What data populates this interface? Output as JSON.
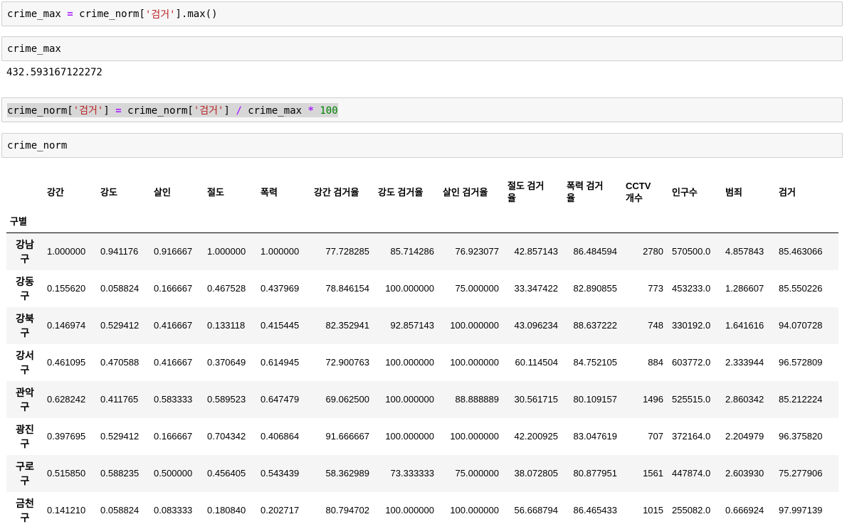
{
  "cells": {
    "c1": {
      "a": "crime_max",
      "b": "=",
      "c": "crime_norm[",
      "d": "'검거'",
      "e": "].max()"
    },
    "c2": {
      "code": "crime_max",
      "output": "432.593167122272"
    },
    "c3": {
      "a": "crime_norm[",
      "b": "'검거'",
      "c": "]",
      "d": "=",
      "e": "crime_norm[",
      "f": "'검거'",
      "g": "]",
      "h": "/",
      "i": "crime_max",
      "j": "*",
      "k": "100"
    },
    "c4": {
      "code": "crime_norm"
    }
  },
  "table": {
    "columns": [
      "강간",
      "강도",
      "살인",
      "절도",
      "폭력",
      "강간 검거율",
      "강도 검거율",
      "살인 검거율",
      "절도 검거\n율",
      "폭력 검거\n율",
      "CCTV\n개수",
      "인구수",
      "범죄",
      "검거"
    ],
    "index_name": "구별",
    "rows": [
      {
        "idx": "강남\n구",
        "vals": [
          "1.000000",
          "0.941176",
          "0.916667",
          "1.000000",
          "1.000000",
          "77.728285",
          "85.714286",
          "76.923077",
          "42.857143",
          "86.484594",
          "2780",
          "570500.0",
          "4.857843",
          "85.463066"
        ]
      },
      {
        "idx": "강동\n구",
        "vals": [
          "0.155620",
          "0.058824",
          "0.166667",
          "0.467528",
          "0.437969",
          "78.846154",
          "100.000000",
          "75.000000",
          "33.347422",
          "82.890855",
          "773",
          "453233.0",
          "1.286607",
          "85.550226"
        ]
      },
      {
        "idx": "강북\n구",
        "vals": [
          "0.146974",
          "0.529412",
          "0.416667",
          "0.133118",
          "0.415445",
          "82.352941",
          "92.857143",
          "100.000000",
          "43.096234",
          "88.637222",
          "748",
          "330192.0",
          "1.641616",
          "94.070728"
        ]
      },
      {
        "idx": "강서\n구",
        "vals": [
          "0.461095",
          "0.470588",
          "0.416667",
          "0.370649",
          "0.614945",
          "72.900763",
          "100.000000",
          "100.000000",
          "60.114504",
          "84.752105",
          "884",
          "603772.0",
          "2.333944",
          "96.572809"
        ]
      },
      {
        "idx": "관악\n구",
        "vals": [
          "0.628242",
          "0.411765",
          "0.583333",
          "0.589523",
          "0.647479",
          "69.062500",
          "100.000000",
          "88.888889",
          "30.561715",
          "80.109157",
          "1496",
          "525515.0",
          "2.860342",
          "85.212224"
        ]
      },
      {
        "idx": "광진\n구",
        "vals": [
          "0.397695",
          "0.529412",
          "0.166667",
          "0.704342",
          "0.406864",
          "91.666667",
          "100.000000",
          "100.000000",
          "42.200925",
          "83.047619",
          "707",
          "372164.0",
          "2.204979",
          "96.375820"
        ]
      },
      {
        "idx": "구로\n구",
        "vals": [
          "0.515850",
          "0.588235",
          "0.500000",
          "0.456405",
          "0.543439",
          "58.362989",
          "73.333333",
          "75.000000",
          "38.072805",
          "80.877951",
          "1561",
          "447874.0",
          "2.603930",
          "75.277906"
        ]
      },
      {
        "idx": "금천\n구",
        "vals": [
          "0.141210",
          "0.058824",
          "0.083333",
          "0.180840",
          "0.202717",
          "80.794702",
          "100.000000",
          "100.000000",
          "56.668794",
          "86.465433",
          "1015",
          "255082.0",
          "0.666924",
          "97.997139"
        ]
      }
    ]
  }
}
